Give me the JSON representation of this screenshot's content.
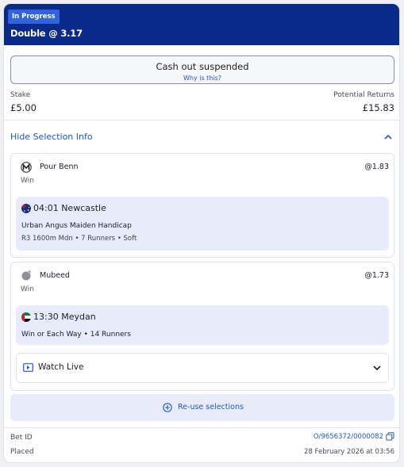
{
  "header": {
    "status_badge": "In Progress",
    "bet_title": "Double @ 3.17"
  },
  "cashout": {
    "label": "Cash out suspended",
    "link": "Why is this?"
  },
  "stake": {
    "label": "Stake",
    "value": "£5.00"
  },
  "returns": {
    "label": "Potential Returns",
    "value": "£15.83"
  },
  "selection_toggle": {
    "label": "Hide Selection Info",
    "icon": "chevron-up-icon"
  },
  "selections": [
    {
      "runner": "Pour Benn",
      "odds": "@1.83",
      "market": "Win",
      "race_time": "04:01 Newcastle",
      "race_name": "Urban Angus Maiden Handicap",
      "race_meta": "R3 1600m Mdn • 7 Runners • Soft",
      "flag": "australia-flag-icon"
    },
    {
      "runner": "Mubeed",
      "odds": "@1.73",
      "market": "Win",
      "race_time": "13:30 Meydan",
      "race_name": "Win or Each Way • 14 Runners",
      "flag": "uae-flag-icon"
    }
  ],
  "watch_live": {
    "label": "Watch Live",
    "icon": "tv-play-icon"
  },
  "reuse": {
    "label": "Re-use selections",
    "icon": "plus-circle-icon"
  },
  "footer": {
    "bet_id_label": "Bet ID",
    "bet_id_value": "O/9656372/0000082",
    "placed_label": "Placed",
    "placed_value": "28 February 2026 at 03:56"
  },
  "colors": {
    "header_bg": "#0a2a8a",
    "badge_bg": "#2f63e0",
    "link": "#1f57c8",
    "race_bg": "#e8ecfa"
  }
}
